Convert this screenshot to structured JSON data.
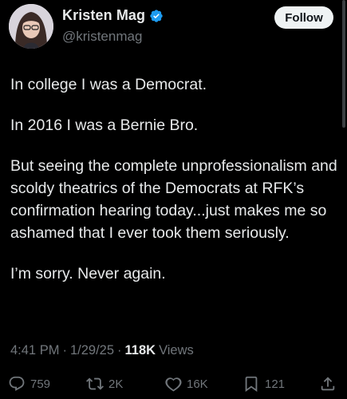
{
  "author": {
    "display_name": "Kristen Mag",
    "handle": "@kristenmag",
    "verified": true
  },
  "follow_label": "Follow",
  "post": {
    "paragraphs": [
      "In college I was a Democrat.",
      "In 2016 I was a Bernie Bro.",
      "But seeing the complete unprofessionalism and scoldy theatrics of the Democrats at RFK’s confirmation hearing today...just makes me so ashamed that I ever took them seriously.",
      "I’m sorry. Never again."
    ]
  },
  "meta": {
    "time": "4:41 PM",
    "separator": "·",
    "date": "1/29/25",
    "views_count": "118K",
    "views_label": "Views"
  },
  "actions": {
    "replies": "759",
    "reposts": "2K",
    "likes": "16K",
    "bookmarks": "121"
  },
  "colors": {
    "background": "#000000",
    "text_primary": "#e7e9ea",
    "text_secondary": "#71767b",
    "verified_blue": "#1d9bf0",
    "follow_bg": "#eff3f4"
  },
  "icons": {
    "verified": "verified-badge-icon",
    "reply": "reply-icon",
    "repost": "repost-icon",
    "like": "heart-icon",
    "bookmark": "bookmark-icon",
    "share": "share-icon"
  }
}
